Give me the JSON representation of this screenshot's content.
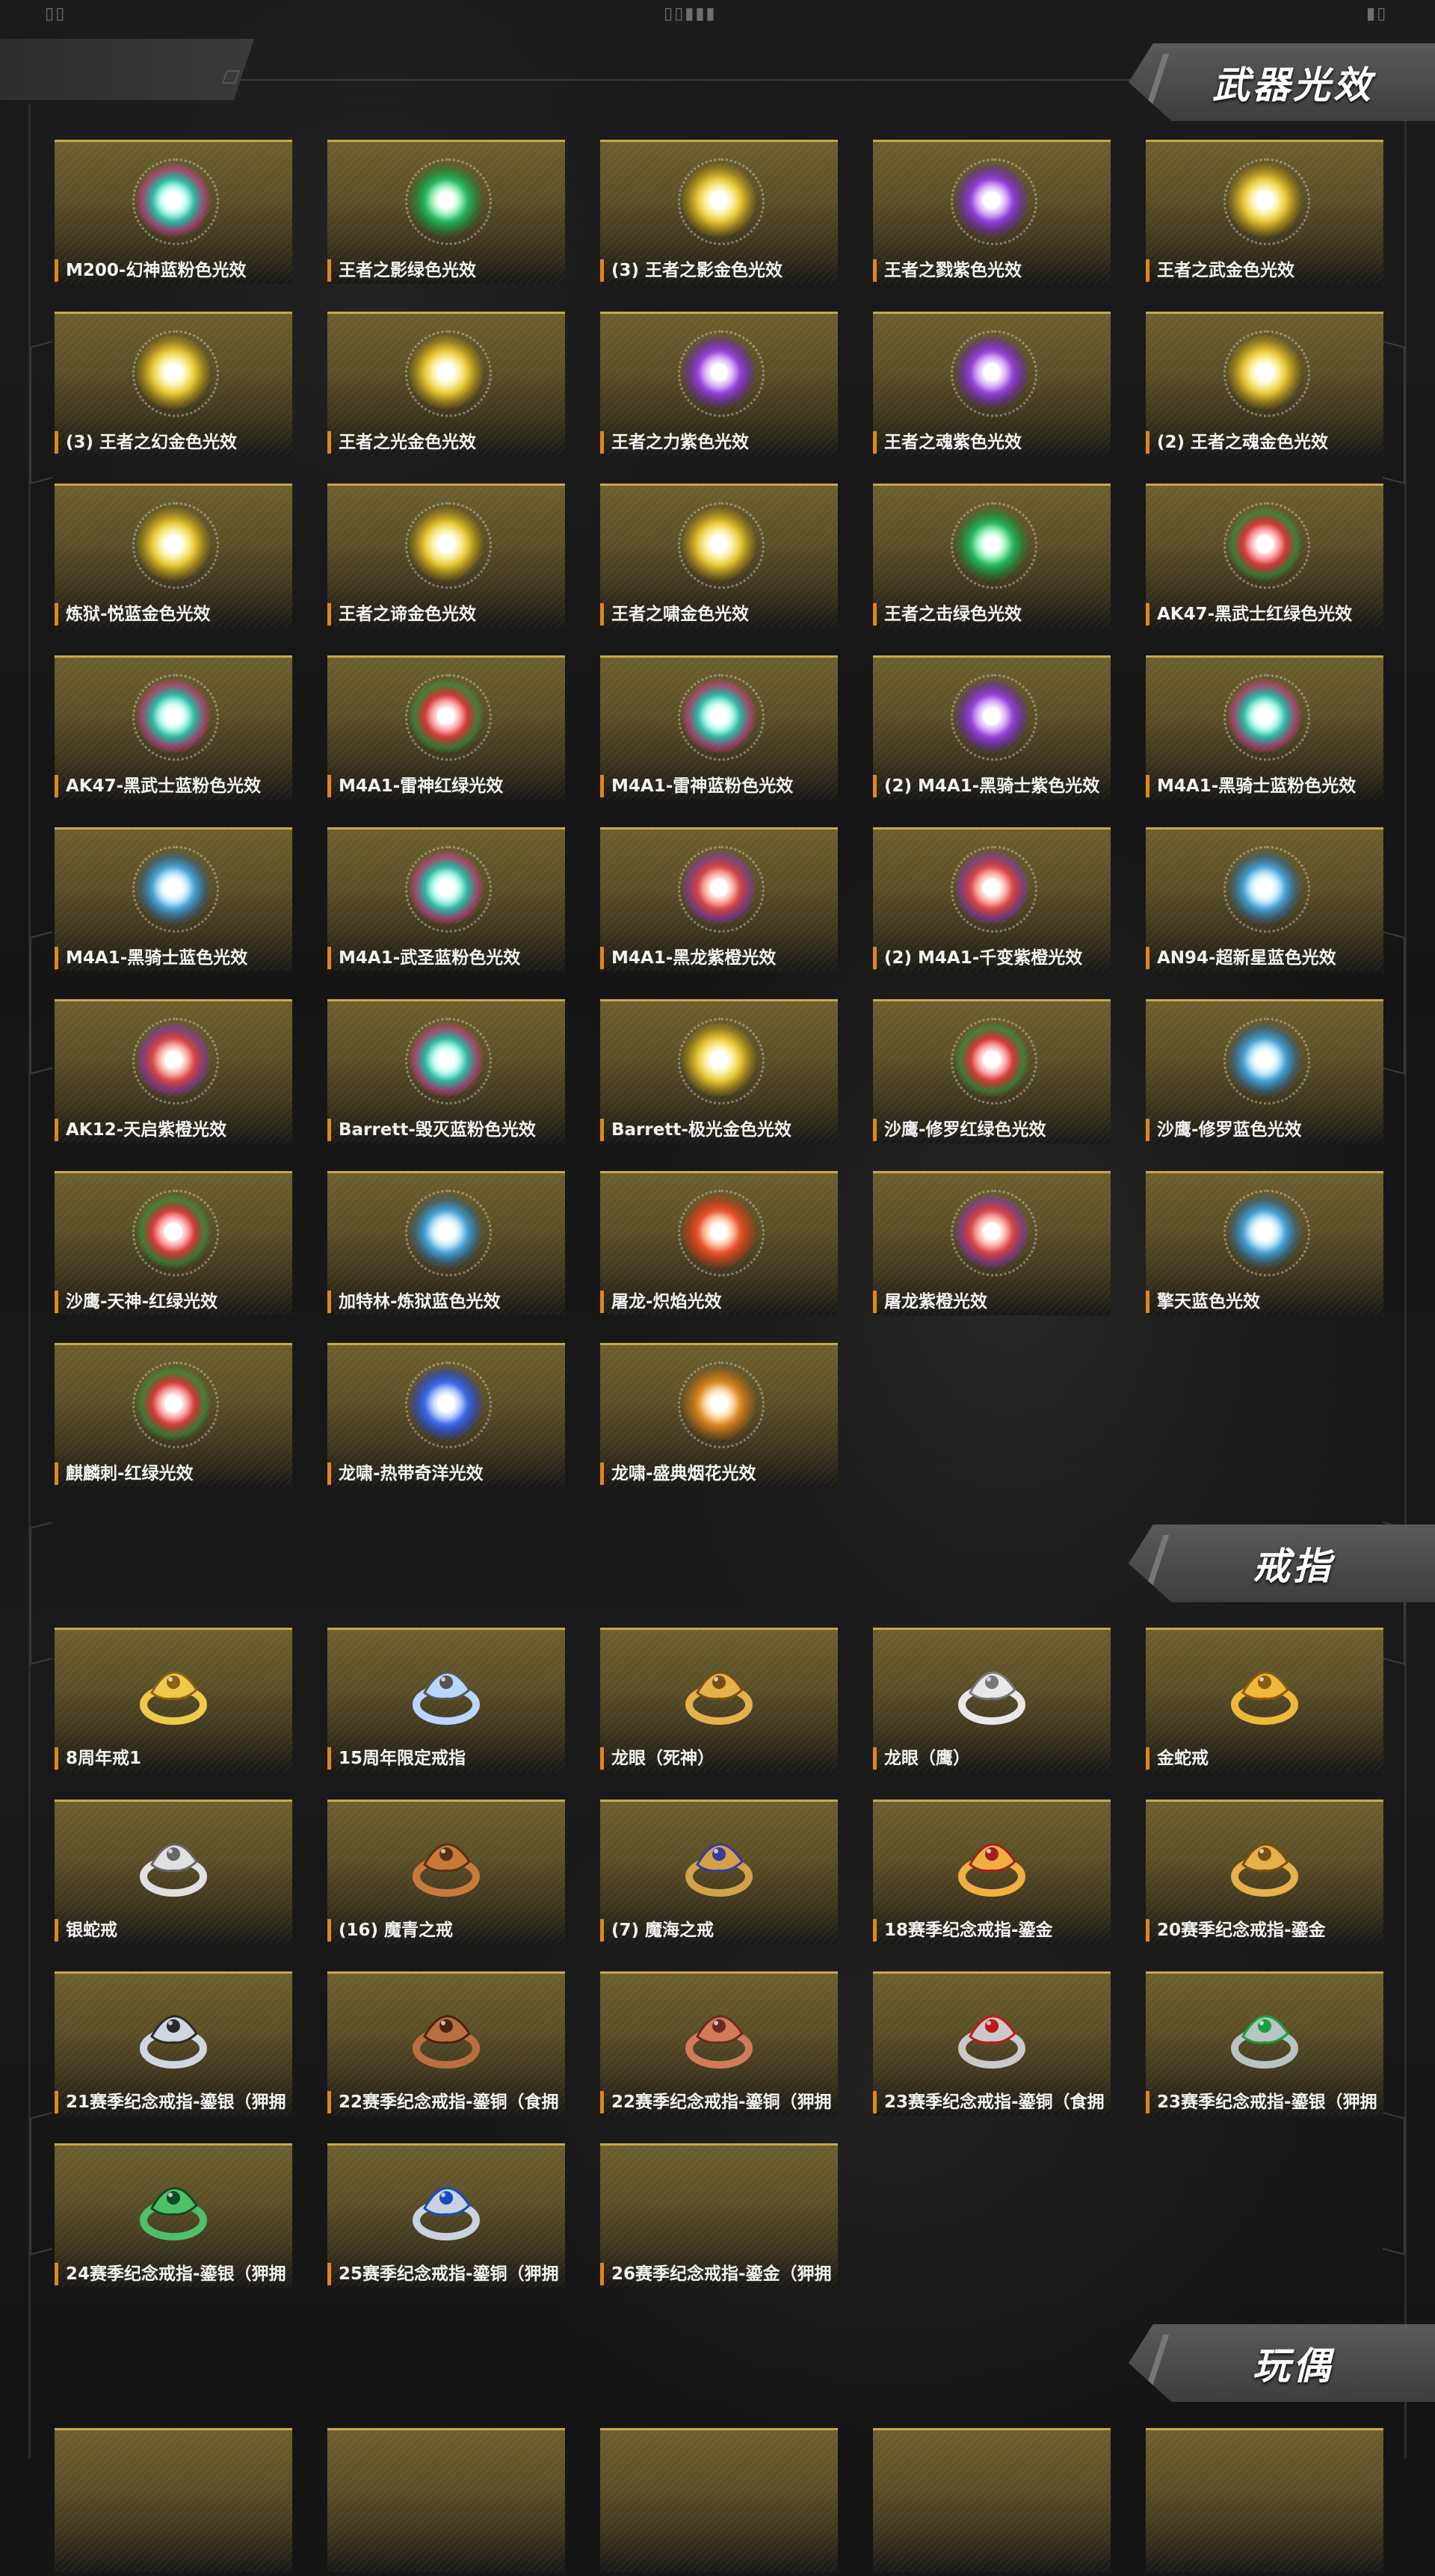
{
  "top_deco": {
    "left": "▯▯",
    "center": "▯▯▮▮▮",
    "right": "▮▯"
  },
  "sections": {
    "weapon_fx": {
      "title": "武器光效"
    },
    "rings": {
      "title": "戒指"
    },
    "dolls": {
      "title": "玩偶"
    }
  },
  "weapon_fx_items": [
    {
      "label": "M200-幻神蓝粉色光效",
      "color": "teal-pink"
    },
    {
      "label": "王者之影绿色光效",
      "color": "green"
    },
    {
      "label": "(3) 王者之影金色光效",
      "color": "gold"
    },
    {
      "label": "王者之戮紫色光效",
      "color": "purple"
    },
    {
      "label": "王者之武金色光效",
      "color": "gold"
    },
    {
      "label": "(3) 王者之幻金色光效",
      "color": "gold"
    },
    {
      "label": "王者之光金色光效",
      "color": "gold"
    },
    {
      "label": "王者之力紫色光效",
      "color": "purple"
    },
    {
      "label": "王者之魂紫色光效",
      "color": "purple"
    },
    {
      "label": "(2) 王者之魂金色光效",
      "color": "gold"
    },
    {
      "label": "炼狱-悦蓝金色光效",
      "color": "gold"
    },
    {
      "label": "王者之谛金色光效",
      "color": "gold"
    },
    {
      "label": "王者之啸金色光效",
      "color": "gold"
    },
    {
      "label": "王者之击绿色光效",
      "color": "green"
    },
    {
      "label": "AK47-黑武士红绿色光效",
      "color": "red-green"
    },
    {
      "label": "AK47-黑武士蓝粉色光效",
      "color": "teal-pink"
    },
    {
      "label": "M4A1-雷神红绿光效",
      "color": "red-green"
    },
    {
      "label": "M4A1-雷神蓝粉色光效",
      "color": "teal-pink"
    },
    {
      "label": "(2) M4A1-黑骑士紫色光效",
      "color": "purple"
    },
    {
      "label": "M4A1-黑骑士蓝粉色光效",
      "color": "teal-pink"
    },
    {
      "label": "M4A1-黑骑士蓝色光效",
      "color": "blue"
    },
    {
      "label": "M4A1-武圣蓝粉色光效",
      "color": "teal-pink"
    },
    {
      "label": "M4A1-黑龙紫橙光效",
      "color": "red-purple"
    },
    {
      "label": "(2) M4A1-千变紫橙光效",
      "color": "red-purple"
    },
    {
      "label": "AN94-超新星蓝色光效",
      "color": "blue"
    },
    {
      "label": "AK12-天启紫橙光效",
      "color": "red-purple"
    },
    {
      "label": "Barrett-毁灭蓝粉色光效",
      "color": "teal-pink"
    },
    {
      "label": "Barrett-极光金色光效",
      "color": "gold"
    },
    {
      "label": "沙鹰-修罗红绿色光效",
      "color": "red-green"
    },
    {
      "label": "沙鹰-修罗蓝色光效",
      "color": "blue"
    },
    {
      "label": "沙鹰-天神-红绿光效",
      "color": "red-green"
    },
    {
      "label": "加特林-炼狱蓝色光效",
      "color": "blue"
    },
    {
      "label": "屠龙-炽焰光效",
      "color": "orange-red"
    },
    {
      "label": "屠龙紫橙光效",
      "color": "red-purple"
    },
    {
      "label": "擎天蓝色光效",
      "color": "blue"
    },
    {
      "label": "麒麟刺-红绿光效",
      "color": "red-green"
    },
    {
      "label": "龙啸-热带奇洋光效",
      "color": "deep-blue"
    },
    {
      "label": "龙啸-盛典烟花光效",
      "color": "amber"
    }
  ],
  "ring_items": [
    {
      "label": "8周年戒1",
      "icon": "gold-ring-icon"
    },
    {
      "label": "15周年限定戒指",
      "icon": "star-ring-icon"
    },
    {
      "label": "龙眼（死神）",
      "icon": "dragon-ring-icon"
    },
    {
      "label": "龙眼（鹰）",
      "icon": "silver-dragon-ring-icon"
    },
    {
      "label": "金蛇戒",
      "icon": "gold-snake-ring-icon"
    },
    {
      "label": "银蛇戒",
      "icon": "silver-snake-ring-icon"
    },
    {
      "label": "(16) 魔青之戒",
      "icon": "demon-ring-icon"
    },
    {
      "label": "(7) 魔海之戒",
      "icon": "sea-demon-ring-icon"
    },
    {
      "label": "18赛季纪念戒指-鎏金",
      "icon": "lion-ring-icon"
    },
    {
      "label": "20赛季纪念戒指-鎏金",
      "icon": "dragon-ring-icon"
    },
    {
      "label": "21赛季纪念戒指-鎏银（狎拥",
      "icon": "tiger-ring-icon"
    },
    {
      "label": "22赛季纪念戒指-鎏铜（食拥",
      "icon": "bronze-ring-icon"
    },
    {
      "label": "22赛季纪念戒指-鎏铜（狎拥",
      "icon": "copper-ring-icon"
    },
    {
      "label": "23赛季纪念戒指-鎏铜（食拥",
      "icon": "ruby-ring-icon"
    },
    {
      "label": "23赛季纪念戒指-鎏银（狎拥",
      "icon": "emerald-ring-icon"
    },
    {
      "label": "24赛季纪念戒指-鎏银（狎拥",
      "icon": "green-dragon-ring-icon"
    },
    {
      "label": "25赛季纪念戒指-鎏铜（狎拥",
      "icon": "blue-ring-icon"
    },
    {
      "label": "26赛季纪念戒指-鎏金（狎拥",
      "icon": "empty-ring-slot"
    }
  ],
  "doll_items": [
    {
      "label": ""
    },
    {
      "label": ""
    },
    {
      "label": ""
    },
    {
      "label": ""
    },
    {
      "label": ""
    }
  ],
  "colors": {
    "accent_orange": "#e0871c",
    "card_gold": "#c9a84c",
    "title_bg": "#4a4a4a"
  }
}
